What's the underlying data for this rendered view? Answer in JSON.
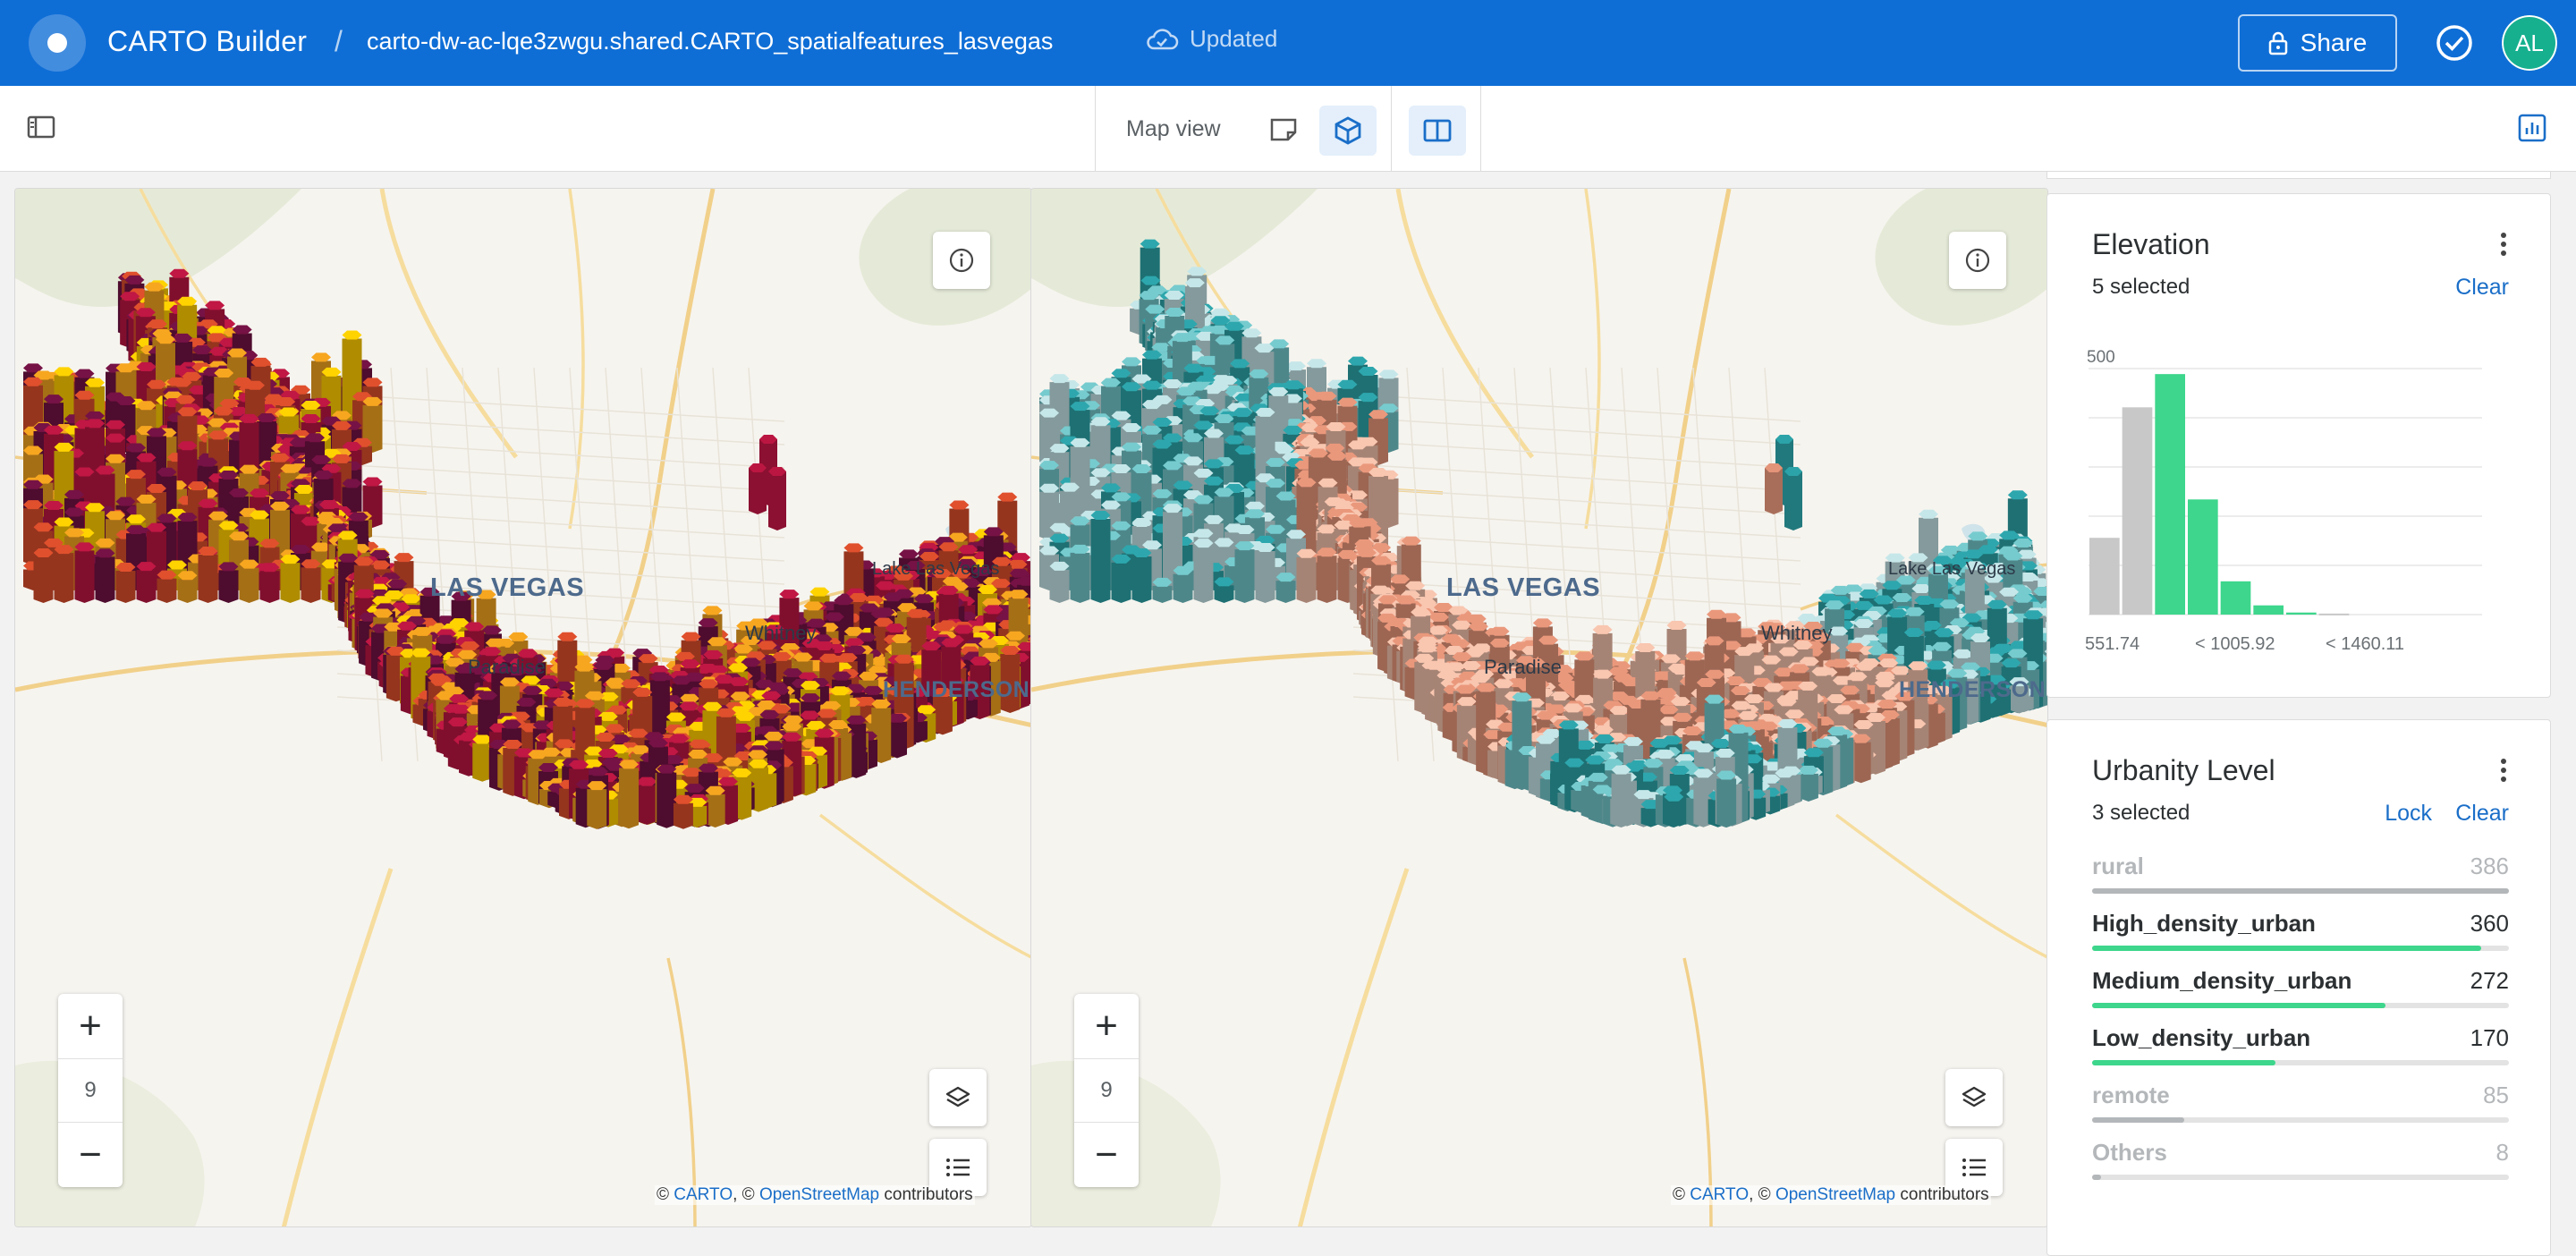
{
  "app": {
    "title": "CARTO Builder",
    "separator": "/",
    "dataset": "carto-dw-ac-lqe3zwgu.shared.CARTO_spatialfeatures_lasvegas",
    "status": "Updated",
    "share_label": "Share",
    "avatar_initials": "AL",
    "brand_color": "#0f6ed6"
  },
  "toolbar": {
    "view_label": "Map view",
    "icons": [
      "panel-toggle-icon",
      "map-2d-icon",
      "map-3d-icon",
      "split-view-icon",
      "widgets-icon"
    ]
  },
  "maps": [
    {
      "id": "left",
      "zoom_level": "9",
      "palette": [
        "#f3c300",
        "#e59a1e",
        "#cf4a2a",
        "#b2153f",
        "#6d1140"
      ],
      "labels": {
        "city": "LAS VEGAS",
        "paradise": "Paradise",
        "whitney": "Whitney",
        "lake": "Lake Las Vegas",
        "henderson": "HENDERSON"
      },
      "attribution": {
        "prefix": "©",
        "carto": "CARTO",
        "mid": ", ©",
        "osm": "OpenStreetMap",
        "suffix": "contributors"
      }
    },
    {
      "id": "right",
      "zoom_level": "9",
      "palette": [
        "#2a9ba0",
        "#6dbcbf",
        "#b7d6d8",
        "#e7b7a3",
        "#d98d73"
      ],
      "labels": {
        "city": "LAS VEGAS",
        "paradise": "Paradise",
        "whitney": "Whitney",
        "lake": "Lake Las Vegas",
        "henderson": "HENDERSON"
      },
      "attribution": {
        "prefix": "©",
        "carto": "CARTO",
        "mid": ", ©",
        "osm": "OpenStreetMap",
        "suffix": "contributors"
      }
    }
  ],
  "widgets": {
    "elevation": {
      "title": "Elevation",
      "selected": "5 selected",
      "clear_label": "Clear",
      "y_max_label": "500",
      "x_tick_labels": [
        "551.74",
        "< 1005.92",
        "< 1460.11"
      ],
      "histogram": {
        "type": "bar",
        "values": [
          150,
          405,
          470,
          225,
          65,
          18,
          4,
          2,
          0,
          0,
          0,
          0
        ],
        "selected": [
          false,
          false,
          true,
          true,
          true,
          true,
          true,
          false,
          false,
          false,
          false,
          false
        ],
        "y_max": 500,
        "selected_color": "#3dd68c",
        "unselected_color": "#c8c8c8"
      }
    },
    "urbanity": {
      "title": "Urbanity Level",
      "selected": "3 selected",
      "lock_label": "Lock",
      "clear_label": "Clear",
      "max_value": 386,
      "categories": [
        {
          "name": "rural",
          "value": 386,
          "selected": false
        },
        {
          "name": "High_density_urban",
          "value": 360,
          "selected": true
        },
        {
          "name": "Medium_density_urban",
          "value": 272,
          "selected": true
        },
        {
          "name": "Low_density_urban",
          "value": 170,
          "selected": true
        },
        {
          "name": "remote",
          "value": 85,
          "selected": false
        },
        {
          "name": "Others",
          "value": 8,
          "selected": false
        }
      ]
    }
  },
  "chart_data": {
    "type": "bar",
    "title": "Elevation",
    "categories": [
      "b1",
      "b2",
      "b3",
      "b4",
      "b5",
      "b6",
      "b7",
      "b8",
      "b9",
      "b10",
      "b11",
      "b12"
    ],
    "values": [
      150,
      405,
      470,
      225,
      65,
      18,
      4,
      2,
      0,
      0,
      0,
      0
    ],
    "x_tick_labels": [
      "551.74",
      "< 1005.92",
      "< 1460.11"
    ],
    "ylim": [
      0,
      500
    ],
    "grid": true
  }
}
